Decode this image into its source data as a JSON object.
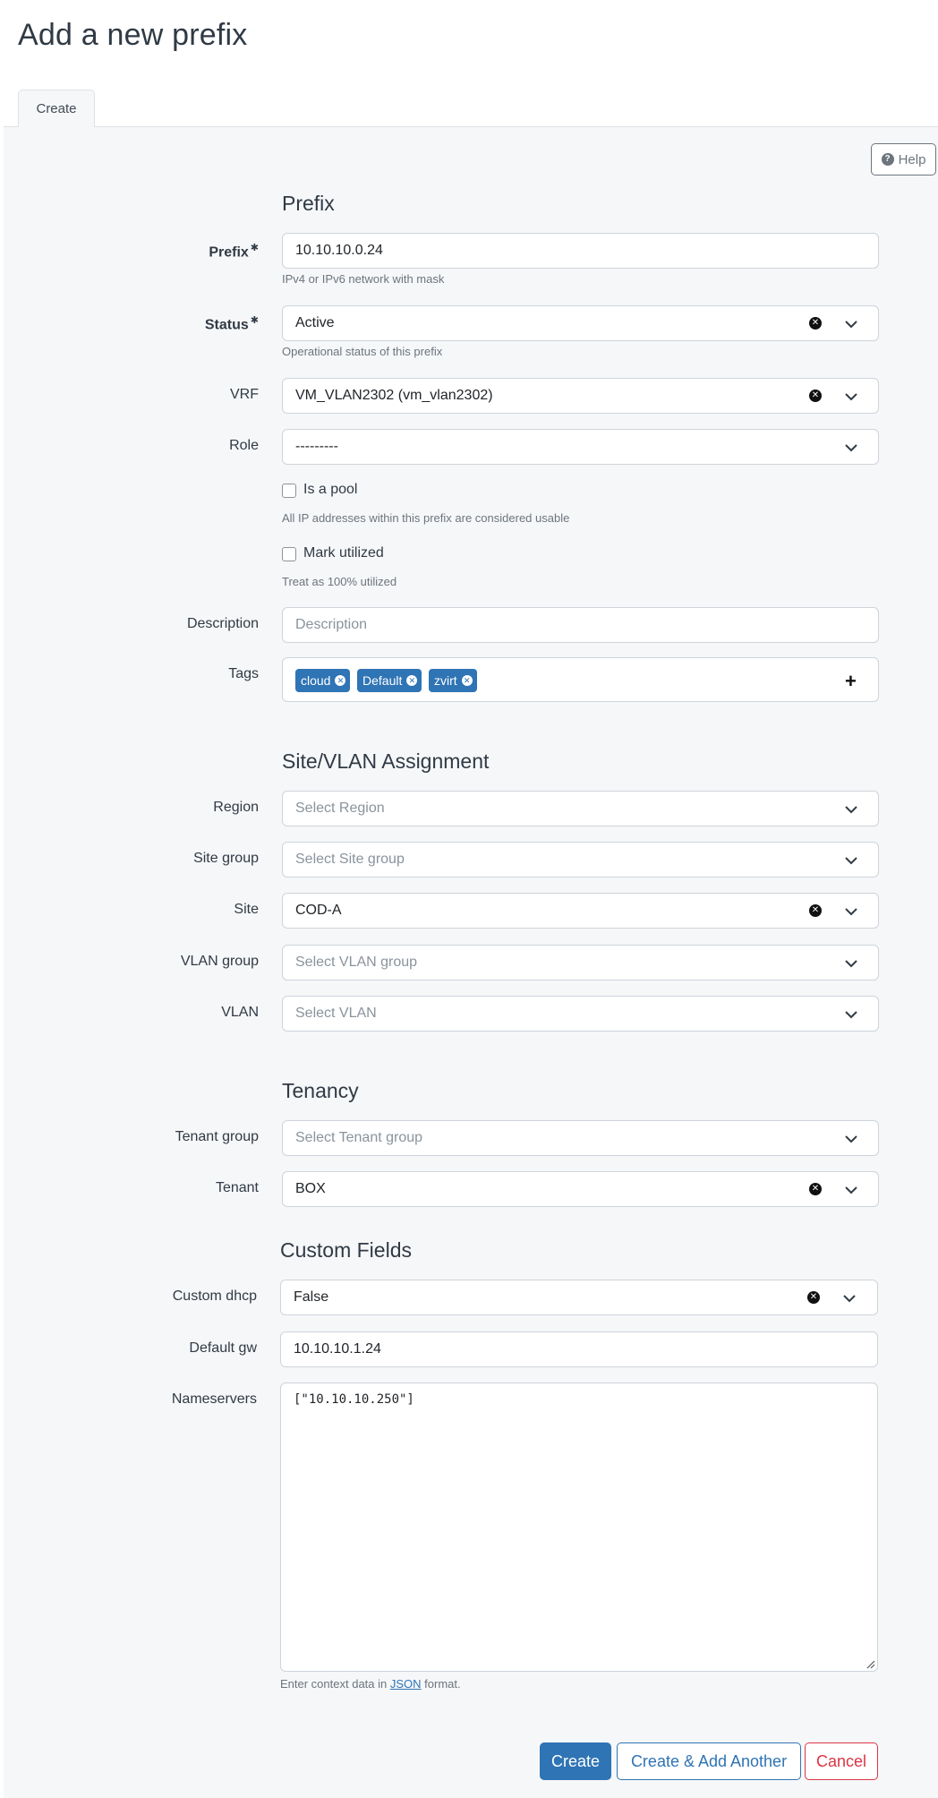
{
  "page": {
    "title": "Add a new prefix"
  },
  "tabs": [
    {
      "label": "Create"
    }
  ],
  "help": {
    "label": "Help"
  },
  "sections": {
    "prefix": "Prefix",
    "site_vlan": "Site/VLAN Assignment",
    "tenancy": "Tenancy",
    "custom_fields": "Custom Fields"
  },
  "fields": {
    "prefix": {
      "label": "Prefix",
      "value": "10.10.10.0.24",
      "help": "IPv4 or IPv6 network with mask"
    },
    "status": {
      "label": "Status",
      "value": "Active",
      "help": "Operational status of this prefix"
    },
    "vrf": {
      "label": "VRF",
      "value": "VM_VLAN2302 (vm_vlan2302)"
    },
    "role": {
      "label": "Role",
      "value": "---------"
    },
    "is_pool": {
      "label": "Is a pool",
      "help": "All IP addresses within this prefix are considered usable",
      "checked": false
    },
    "mark_utilized": {
      "label": "Mark utilized",
      "help": "Treat as 100% utilized",
      "checked": false
    },
    "description": {
      "label": "Description",
      "placeholder": "Description"
    },
    "tags": {
      "label": "Tags",
      "items": [
        "cloud",
        "Default",
        "zvirt"
      ]
    },
    "region": {
      "label": "Region",
      "placeholder": "Select Region"
    },
    "site_group": {
      "label": "Site group",
      "placeholder": "Select Site group"
    },
    "site": {
      "label": "Site",
      "value": "COD-A"
    },
    "vlan_group": {
      "label": "VLAN group",
      "placeholder": "Select VLAN group"
    },
    "vlan": {
      "label": "VLAN",
      "placeholder": "Select VLAN"
    },
    "tenant_group": {
      "label": "Tenant group",
      "placeholder": "Select Tenant group"
    },
    "tenant": {
      "label": "Tenant",
      "value": "BOX"
    },
    "custom_dhcp": {
      "label": "Custom dhcp",
      "value": "False"
    },
    "default_gw": {
      "label": "Default gw",
      "value": "10.10.10.1.24"
    },
    "nameservers": {
      "label": "Nameservers",
      "value": "[\"10.10.10.250\"]",
      "help_prefix": "Enter context data in",
      "help_link": "JSON",
      "help_suffix": "format."
    }
  },
  "buttons": {
    "create": "Create",
    "create_add_another": "Create & Add Another",
    "cancel": "Cancel"
  },
  "colors": {
    "primary": "#2f74b5",
    "danger": "#dc3545",
    "panel_bg": "#f6f7f9"
  }
}
